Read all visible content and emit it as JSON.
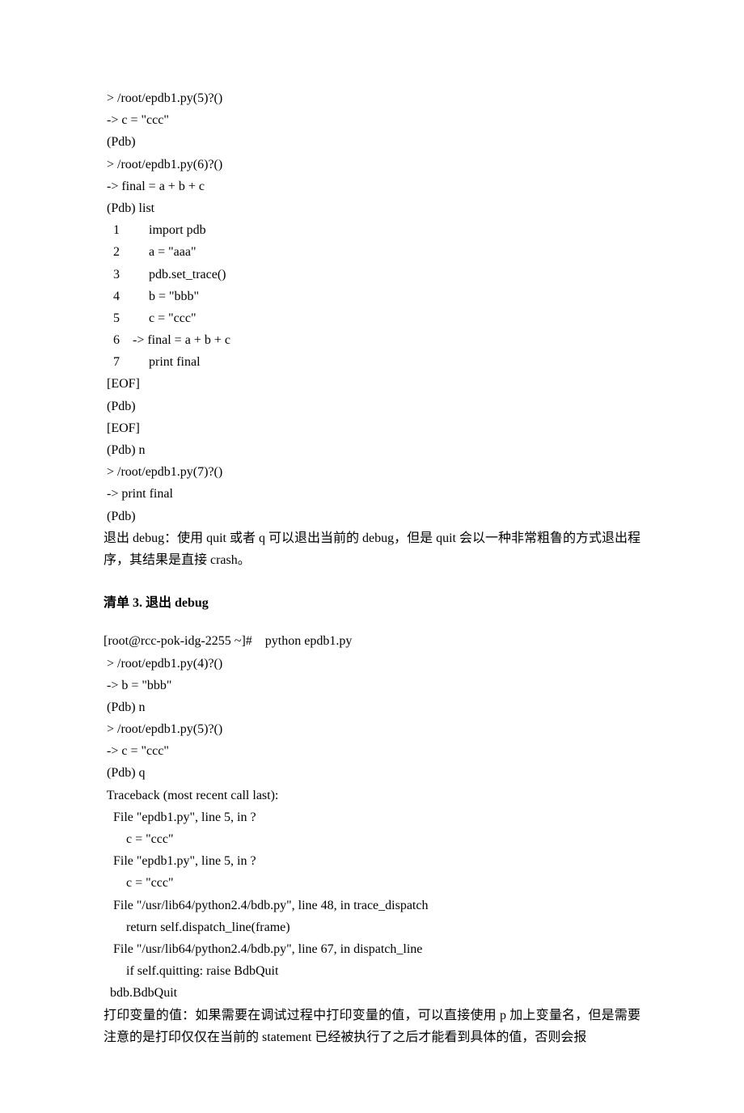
{
  "code1": {
    "lines": [
      " > /root/epdb1.py(5)?()",
      " -> c = \"ccc\"",
      " (Pdb)",
      " > /root/epdb1.py(6)?()",
      " -> final = a + b + c",
      " (Pdb) list",
      "   1         import pdb",
      "   2         a = \"aaa\"",
      "   3         pdb.set_trace()",
      "   4         b = \"bbb\"",
      "   5         c = \"ccc\"",
      "   6    -> final = a + b + c",
      "   7         print final",
      " [EOF]",
      " (Pdb)",
      " [EOF]",
      " (Pdb) n",
      " > /root/epdb1.py(7)?()",
      " -> print final",
      " (Pdb)"
    ]
  },
  "para1": "退出  debug：使用  quit  或者  q  可以退出当前的  debug，但是  quit  会以一种非常粗鲁的方式退出程序，其结果是直接  crash。",
  "heading1": "清单  3.  退出  debug",
  "code2": {
    "lines": [
      "[root@rcc-pok-idg-2255 ~]#    python epdb1.py",
      " > /root/epdb1.py(4)?()",
      " -> b = \"bbb\"",
      " (Pdb) n",
      " > /root/epdb1.py(5)?()",
      " -> c = \"ccc\"",
      " (Pdb) q",
      " Traceback (most recent call last):",
      "   File \"epdb1.py\", line 5, in ?",
      "       c = \"ccc\"",
      "   File \"epdb1.py\", line 5, in ?",
      "       c = \"ccc\"",
      "   File \"/usr/lib64/python2.4/bdb.py\", line 48, in trace_dispatch",
      "       return self.dispatch_line(frame)",
      "   File \"/usr/lib64/python2.4/bdb.py\", line 67, in dispatch_line",
      "       if self.quitting: raise BdbQuit",
      "  bdb.BdbQuit"
    ]
  },
  "para2": "打印变量的值：如果需要在调试过程中打印变量的值，可以直接使用  p  加上变量名，但是需要注意的是打印仅仅在当前的  statement  已经被执行了之后才能看到具体的值，否则会报"
}
